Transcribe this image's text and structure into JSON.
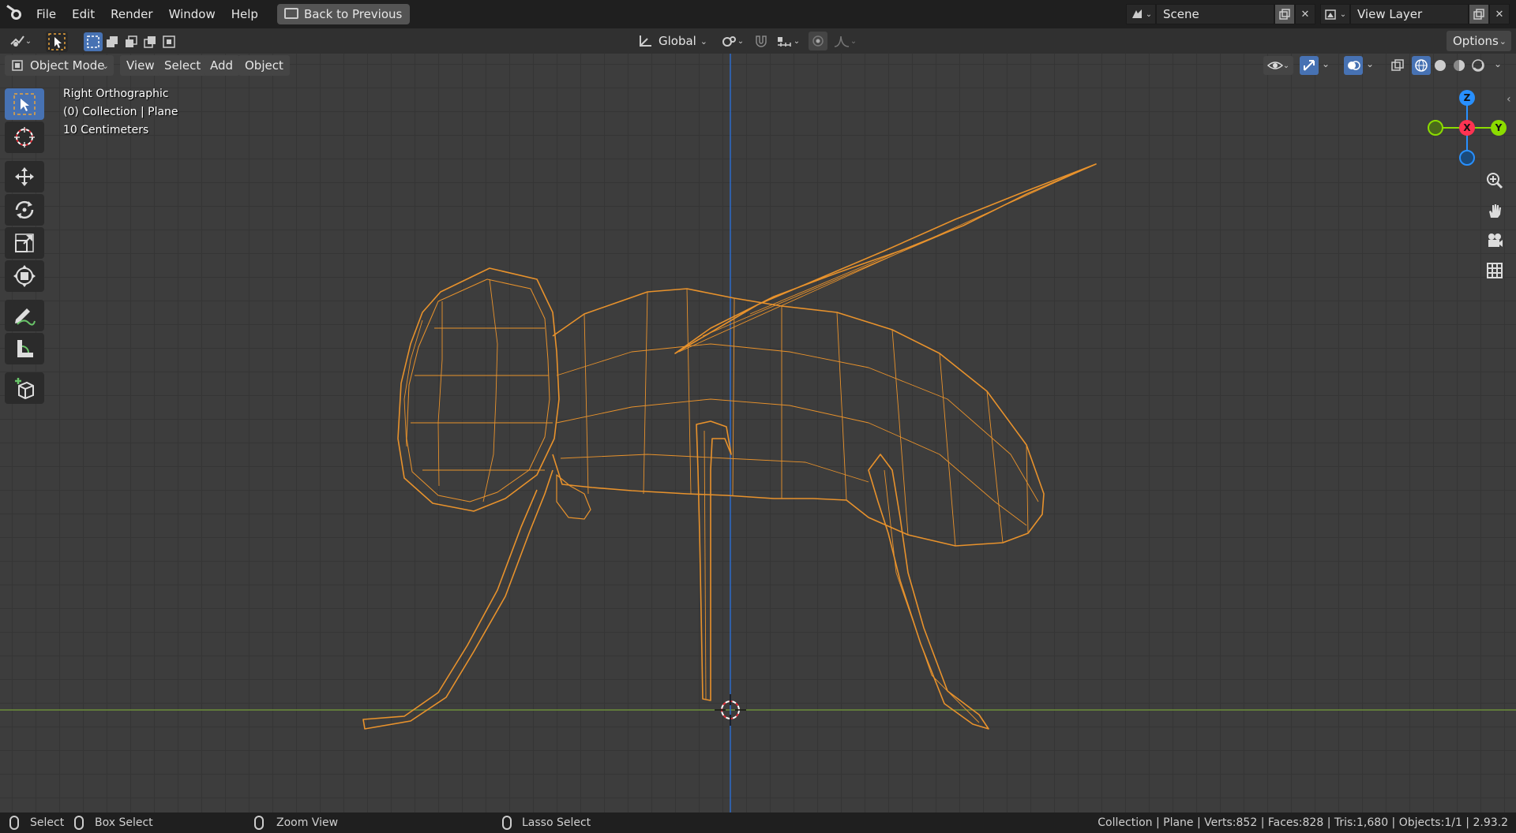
{
  "menu": {
    "items": [
      "File",
      "Edit",
      "Render",
      "Window",
      "Help"
    ],
    "back_button": "Back to Previous"
  },
  "scene": {
    "label": "Scene",
    "icon": "scene-icon"
  },
  "view_layer": {
    "label": "View Layer",
    "icon": "view-layer-icon"
  },
  "tool_header": {
    "transform_orientation": "Global",
    "options_label": "Options"
  },
  "view_header": {
    "mode": "Object Mode",
    "menus": [
      "View",
      "Select",
      "Add",
      "Object"
    ]
  },
  "overlay": {
    "view_name": "Right Orthographic",
    "collection_info": "(0) Collection | Plane",
    "scale_info": "10 Centimeters"
  },
  "gizmo": {
    "z": "Z",
    "x": "X",
    "y": "Y"
  },
  "status": {
    "select": "Select",
    "box_select": "Box Select",
    "zoom_view": "Zoom View",
    "lasso_select": "Lasso Select",
    "stats": "Collection | Plane | Verts:852 | Faces:828 | Tris:1,680 | Objects:1/1 | 2.93.2"
  },
  "colors": {
    "accent": "#4772b3",
    "wire": "#e8922c",
    "axis_x": "#ff3352",
    "axis_y": "#8bdc00",
    "axis_z": "#2890ff"
  }
}
